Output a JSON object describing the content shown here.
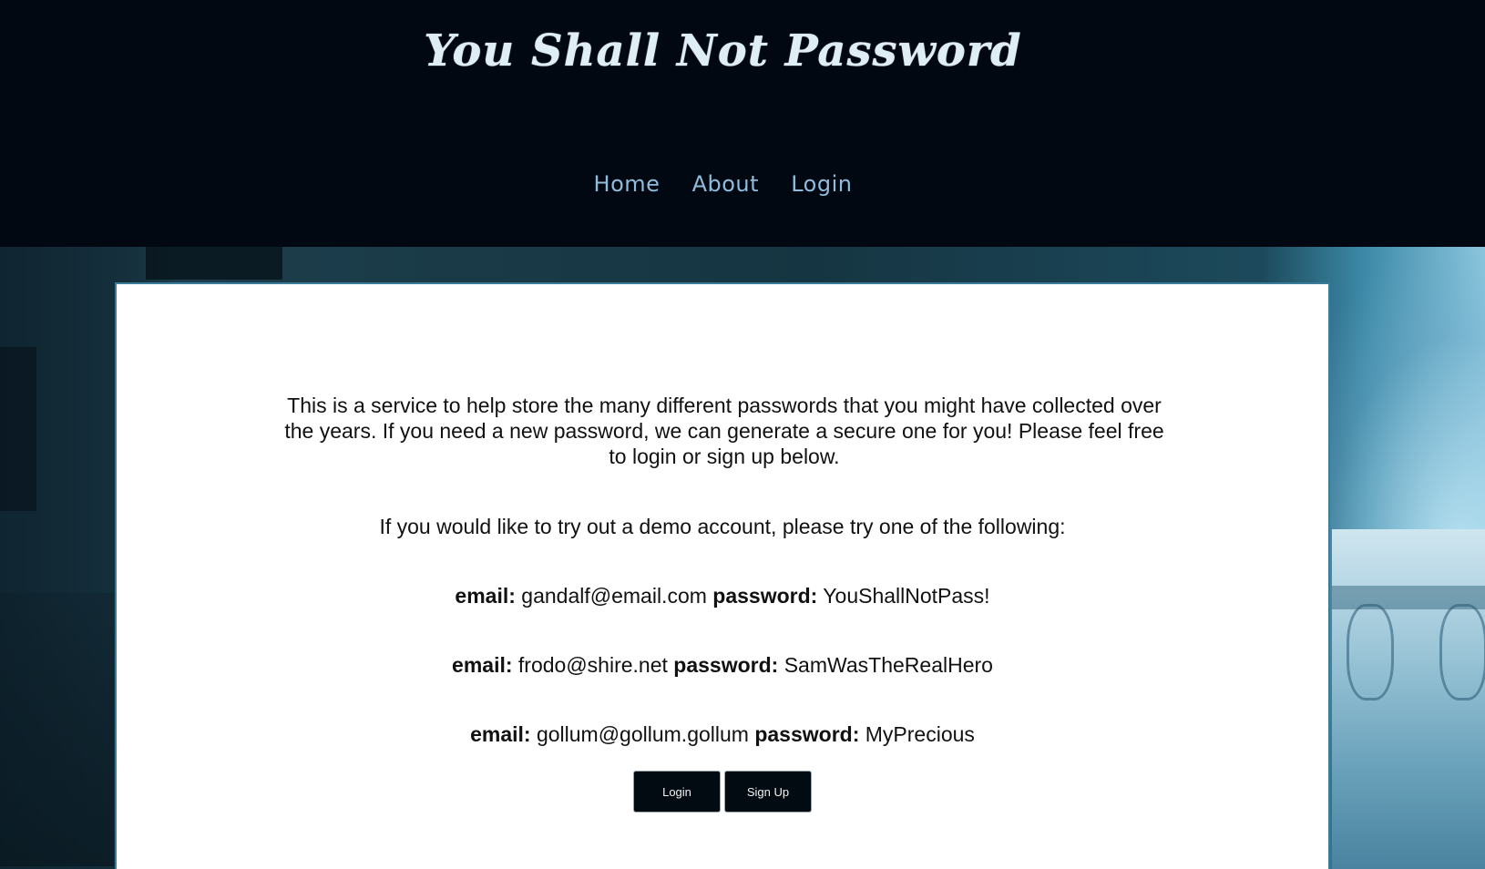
{
  "site": {
    "title": "You Shall Not Password"
  },
  "nav": {
    "items": [
      {
        "label": "Home"
      },
      {
        "label": "About"
      },
      {
        "label": "Login"
      }
    ]
  },
  "main": {
    "intro": "This is a service to help store the many different passwords that you might have collected over the years. If you need a new password, we can generate a secure one for you! Please feel free to login or sign up below.",
    "demo_heading": "If you would like to try out a demo account, please try one of the following:",
    "email_label": "email:",
    "password_label": "password:",
    "credentials": [
      {
        "email": "gandalf@email.com",
        "password": "YouShallNotPass!"
      },
      {
        "email": "frodo@shire.net",
        "password": "SamWasTheRealHero"
      },
      {
        "email": "gollum@gollum.gollum",
        "password": "MyPrecious"
      }
    ],
    "buttons": {
      "login": "Login",
      "signup": "Sign Up"
    }
  },
  "colors": {
    "header_bg": "#010811",
    "nav_link": "#8fbcdc",
    "title": "#dfeef6",
    "button_bg": "#020a12",
    "panel_border": "#3b7c99"
  }
}
